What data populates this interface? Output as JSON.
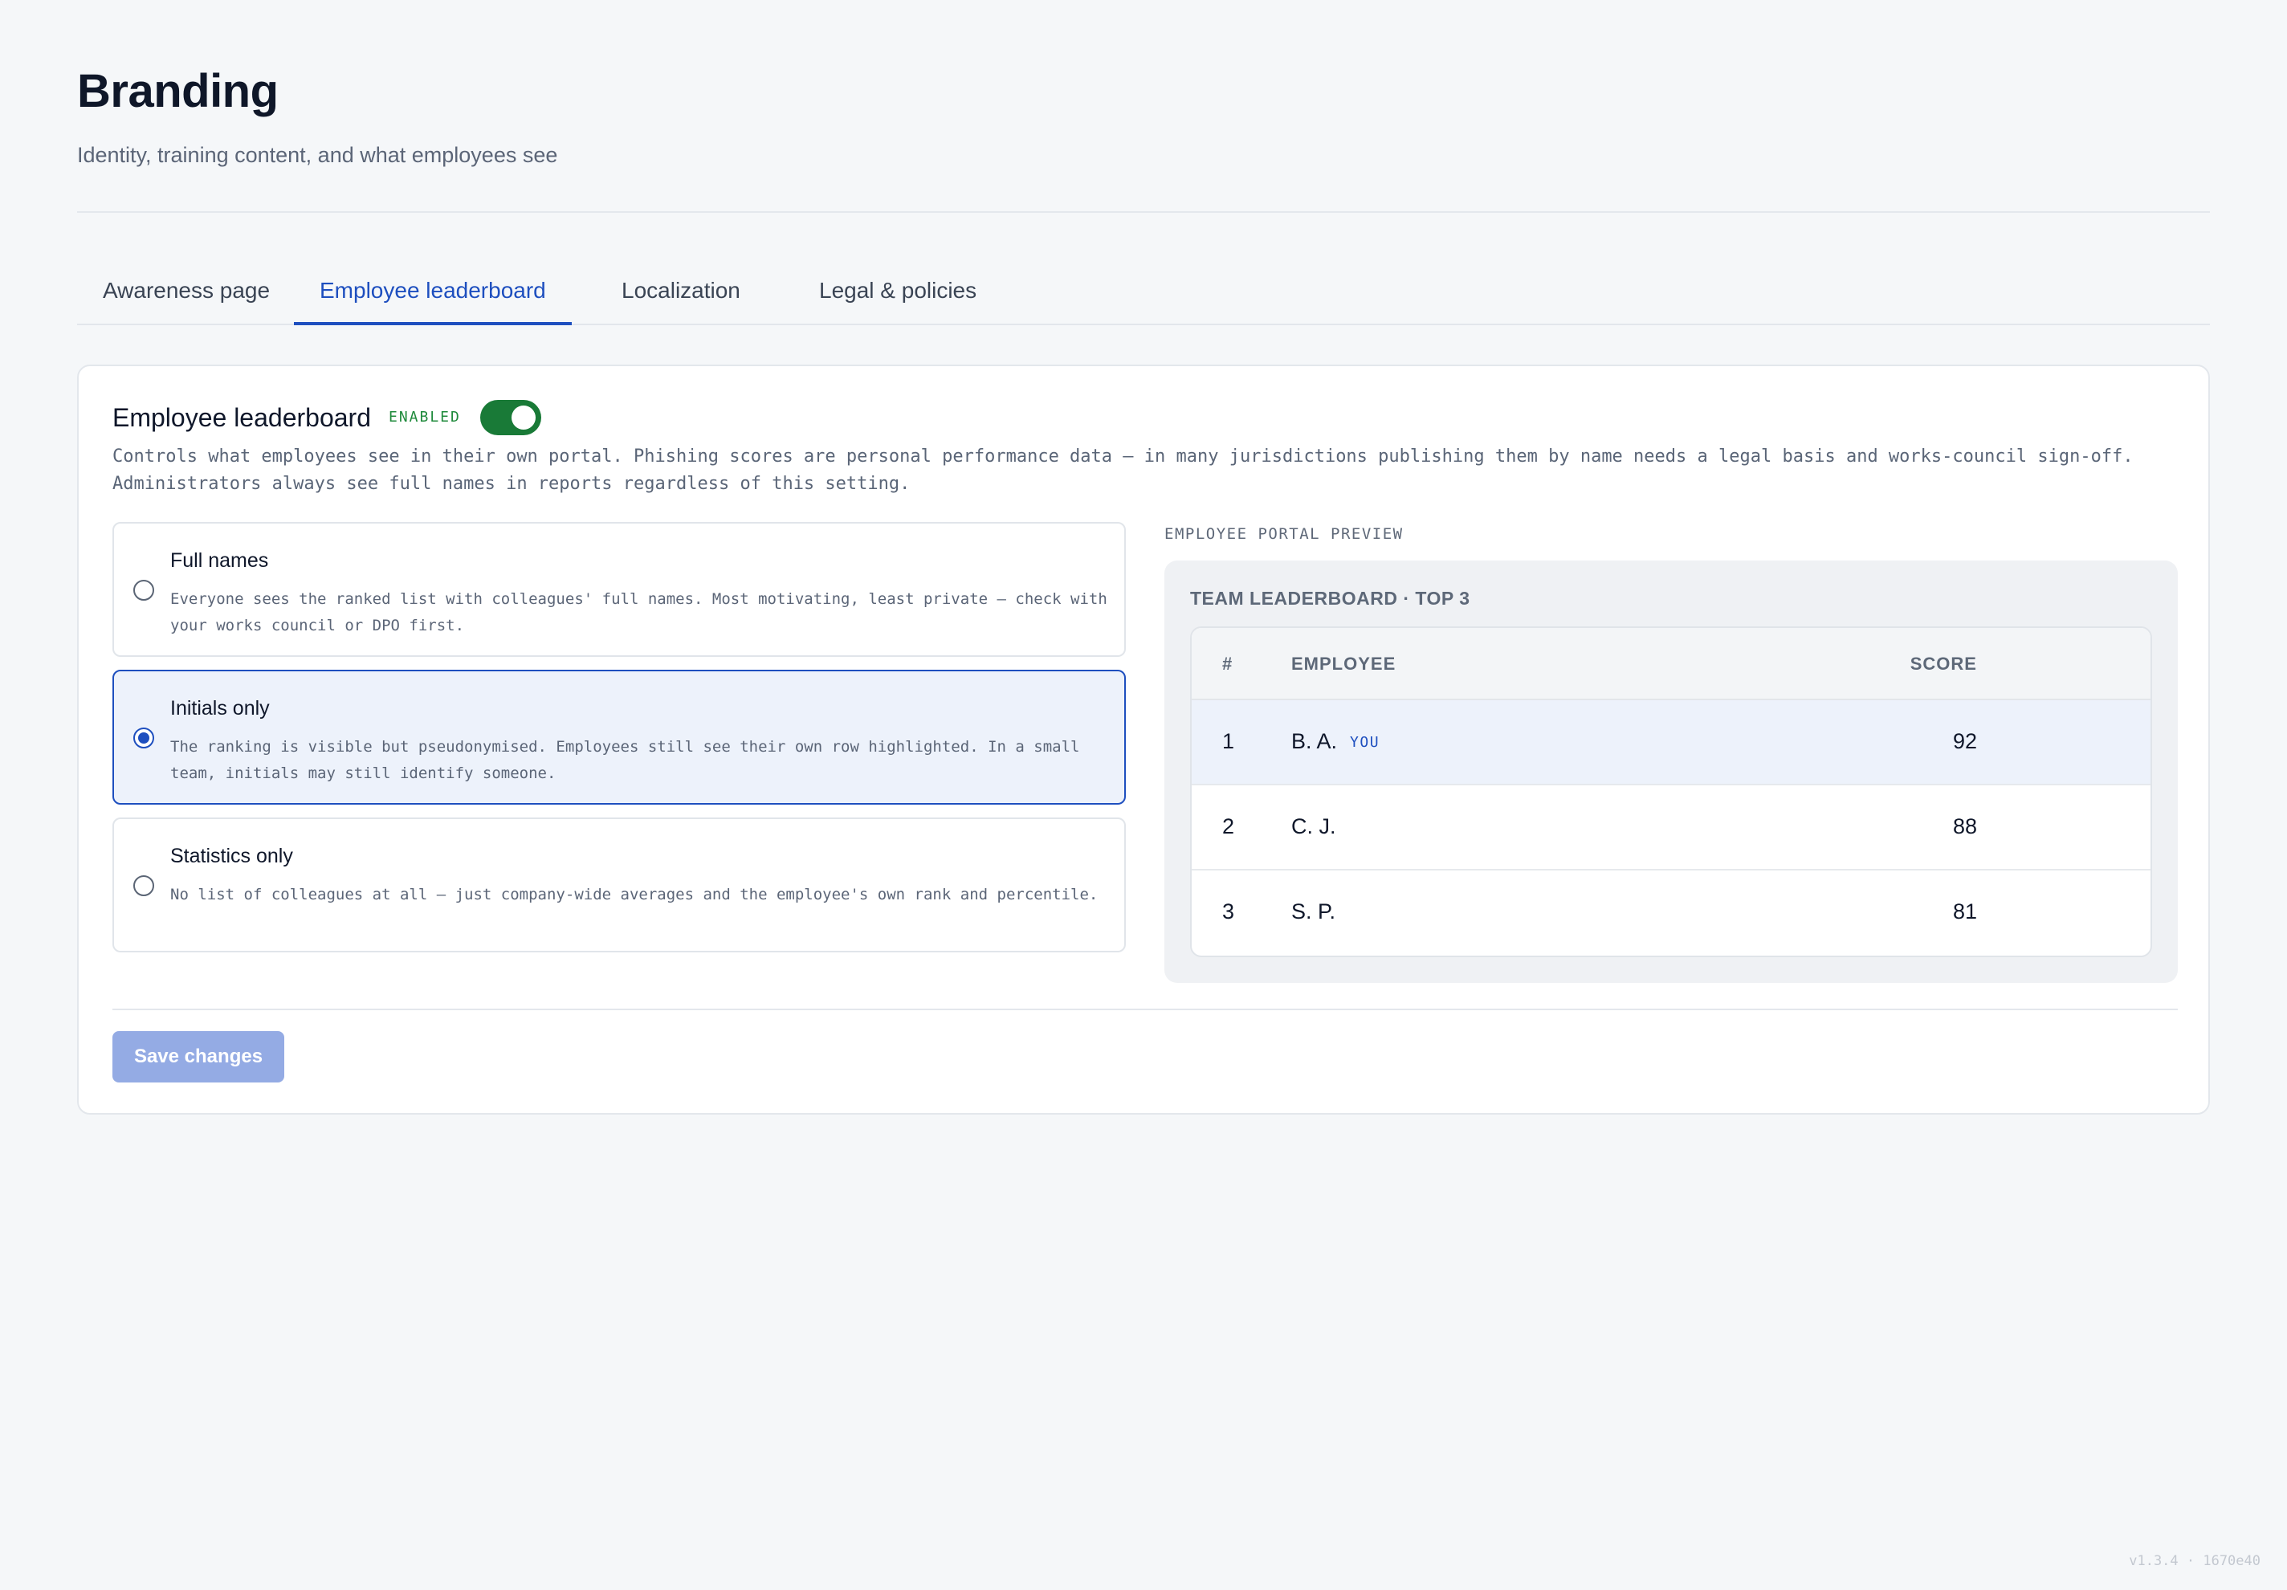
{
  "header": {
    "title": "Branding",
    "subtitle": "Identity, training content, and what employees see"
  },
  "tabs": [
    {
      "label": "Awareness page",
      "active": false
    },
    {
      "label": "Employee leaderboard",
      "active": true
    },
    {
      "label": "Localization",
      "active": false
    },
    {
      "label": "Legal & policies",
      "active": false
    }
  ],
  "card": {
    "title": "Employee leaderboard",
    "status_badge": "ENABLED",
    "toggle_on": true,
    "description": "Controls what employees see in their own portal. Phishing scores are personal performance data — in many jurisdictions publishing them by name needs a legal basis and works-council sign-off. Administrators always see full names in reports regardless of this setting."
  },
  "options": [
    {
      "title": "Full names",
      "description": "Everyone sees the ranked list with colleagues' full names. Most motivating, least private — check with your works council or DPO first.",
      "selected": false
    },
    {
      "title": "Initials only",
      "description": "The ranking is visible but pseudonymised. Employees still see their own row highlighted. In a small team, initials may still identify someone.",
      "selected": true
    },
    {
      "title": "Statistics only",
      "description": "No list of colleagues at all — just company-wide averages and the employee's own rank and percentile.",
      "selected": false
    }
  ],
  "preview": {
    "label": "EMPLOYEE PORTAL PREVIEW",
    "heading": "TEAM LEADERBOARD · TOP 3",
    "columns": {
      "rank": "#",
      "employee": "EMPLOYEE",
      "score": "SCORE"
    },
    "rows": [
      {
        "rank": "1",
        "name": "B. A.",
        "tag": "YOU",
        "score": "92"
      },
      {
        "rank": "2",
        "name": "C. J.",
        "tag": "",
        "score": "88"
      },
      {
        "rank": "3",
        "name": "S. P.",
        "tag": "",
        "score": "81"
      }
    ]
  },
  "actions": {
    "save_label": "Save changes"
  },
  "footer": {
    "version": "v1.3.4 · 1670e40"
  },
  "colors": {
    "accent": "#1e4fbf",
    "toggle_on": "#197a37",
    "enabled_text": "#1f8a3b",
    "save_button_disabled": "#94abe4",
    "selected_option_bg": "#edf2fb"
  }
}
